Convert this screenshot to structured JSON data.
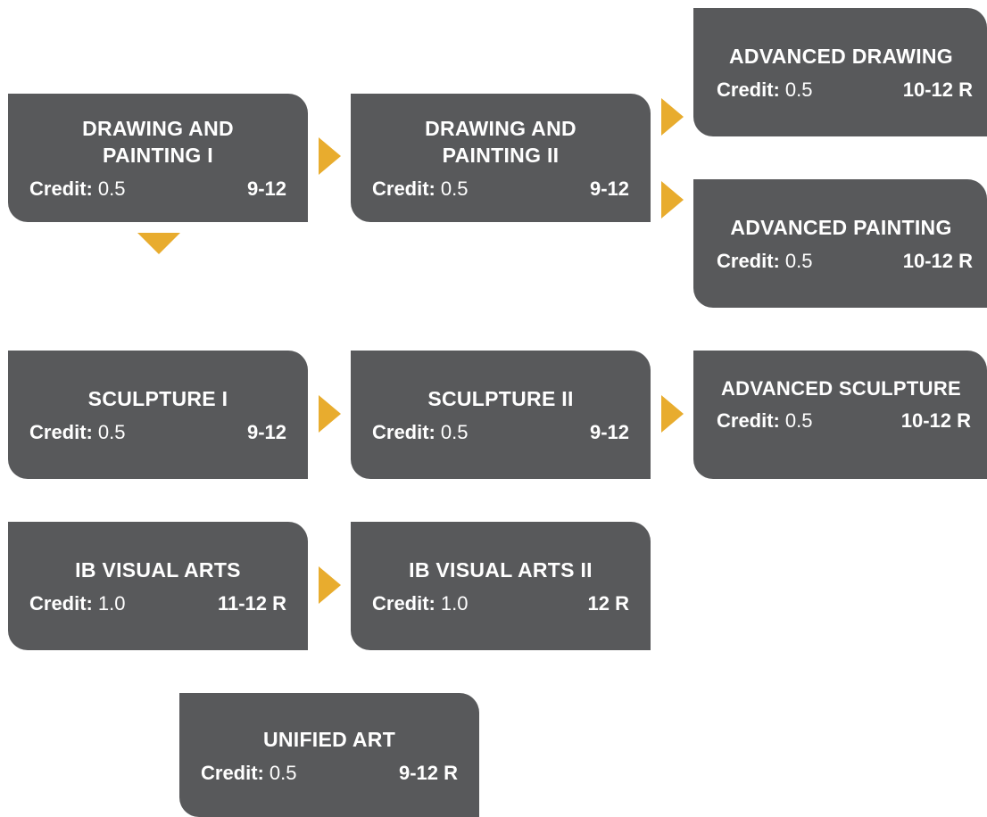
{
  "credit_label": "Credit:",
  "colors": {
    "box": "#58595b",
    "arrow": "#e8ac2e",
    "text": "#ffffff"
  },
  "courses": {
    "dp1": {
      "title": "DRAWING AND\nPAINTING I",
      "credit": "0.5",
      "grades": "9-12"
    },
    "dp2": {
      "title": "DRAWING AND\nPAINTING II",
      "credit": "0.5",
      "grades": "9-12"
    },
    "adv_drawing": {
      "title": "ADVANCED DRAWING",
      "credit": "0.5",
      "grades": "10-12 R"
    },
    "adv_painting": {
      "title": "ADVANCED PAINTING",
      "credit": "0.5",
      "grades": "10-12 R"
    },
    "sculpture1": {
      "title": "SCULPTURE I",
      "credit": "0.5",
      "grades": "9-12"
    },
    "sculpture2": {
      "title": "SCULPTURE II",
      "credit": "0.5",
      "grades": "9-12"
    },
    "adv_sculpture": {
      "title": "ADVANCED SCULPTURE",
      "credit": "0.5",
      "grades": "10-12 R"
    },
    "ib1": {
      "title": "IB VISUAL ARTS",
      "credit": "1.0",
      "grades": "11-12 R"
    },
    "ib2": {
      "title": "IB VISUAL ARTS II",
      "credit": "1.0",
      "grades": "12 R"
    },
    "unified": {
      "title": "UNIFIED ART",
      "credit": "0.5",
      "grades": "9-12 R"
    }
  }
}
